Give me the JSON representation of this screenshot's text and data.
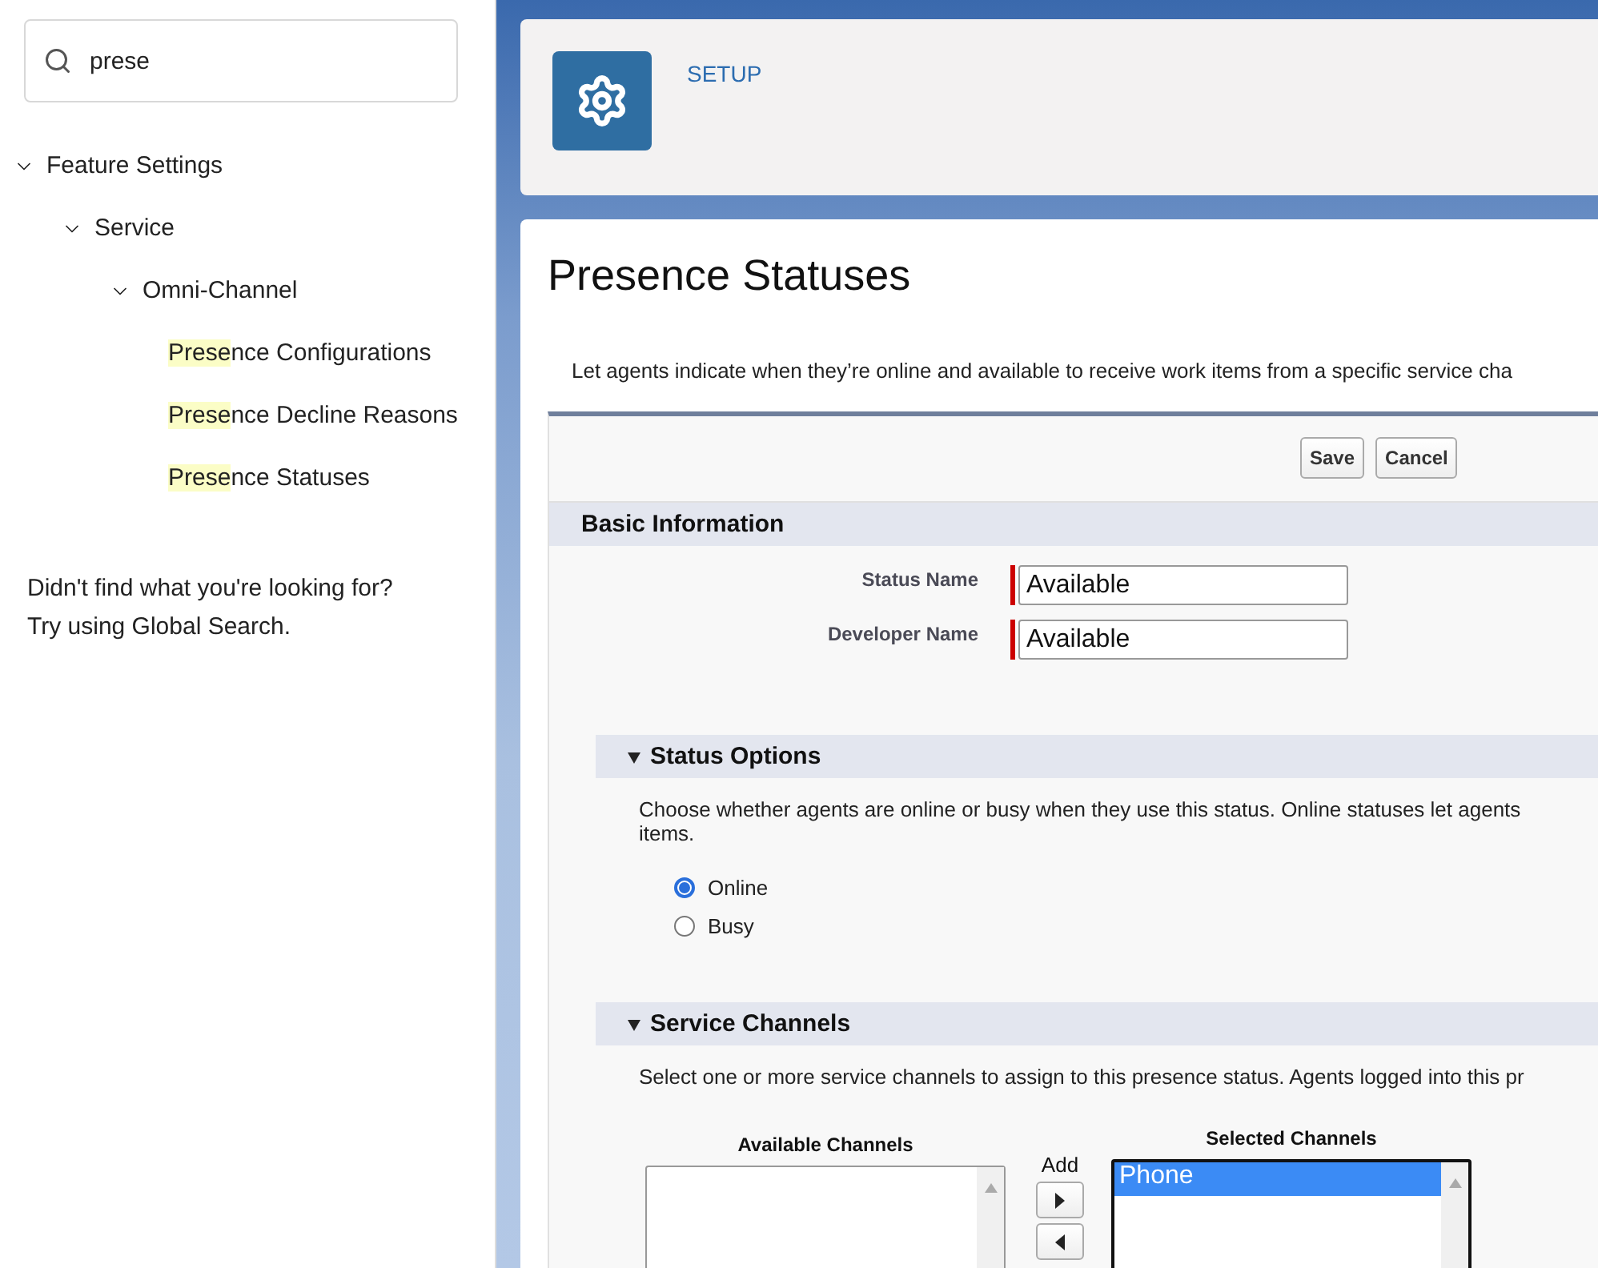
{
  "sidebar": {
    "search": {
      "value": "prese"
    },
    "tree": [
      {
        "label": "Feature Settings",
        "expanded": true,
        "children": [
          {
            "label": "Service",
            "expanded": true,
            "children": [
              {
                "label": "Omni-Channel",
                "expanded": true,
                "children": [
                  {
                    "match": "Prese",
                    "rest": "nce Configurations"
                  },
                  {
                    "match": "Prese",
                    "rest": "nce Decline Reasons"
                  },
                  {
                    "match": "Prese",
                    "rest": "nce Statuses"
                  }
                ]
              }
            ]
          }
        ]
      }
    ],
    "help_lines": [
      "Didn't find what you're looking for?",
      "Try using Global Search."
    ]
  },
  "header": {
    "breadcrumb": "SETUP"
  },
  "page": {
    "title": "Presence Statuses",
    "description": "Let agents indicate when they’re online and available to receive work items from a specific service cha"
  },
  "form": {
    "buttons": [
      "Save",
      "Cancel"
    ],
    "basic_information": {
      "title": "Basic Information",
      "fields": [
        {
          "label": "Status Name",
          "value": "Available",
          "required": true
        },
        {
          "label": "Developer Name",
          "value": "Available",
          "required": true
        }
      ]
    },
    "status_options": {
      "title": "Status Options",
      "expanded": true,
      "description_lines": [
        "Choose whether agents are online or busy when they use this status. Online statuses let agents",
        "items."
      ],
      "options": [
        {
          "label": "Online",
          "selected": true
        },
        {
          "label": "Busy",
          "selected": false
        }
      ]
    },
    "service_channels": {
      "title": "Service Channels",
      "expanded": true,
      "description": "Select one or more service channels to assign to this presence status. Agents logged into this pr",
      "available": {
        "title": "Available Channels"
      },
      "add_label": "Add",
      "selected_list": {
        "title": "Selected Channels",
        "items": [
          {
            "label": "Phone",
            "selected": true
          }
        ]
      }
    }
  }
}
